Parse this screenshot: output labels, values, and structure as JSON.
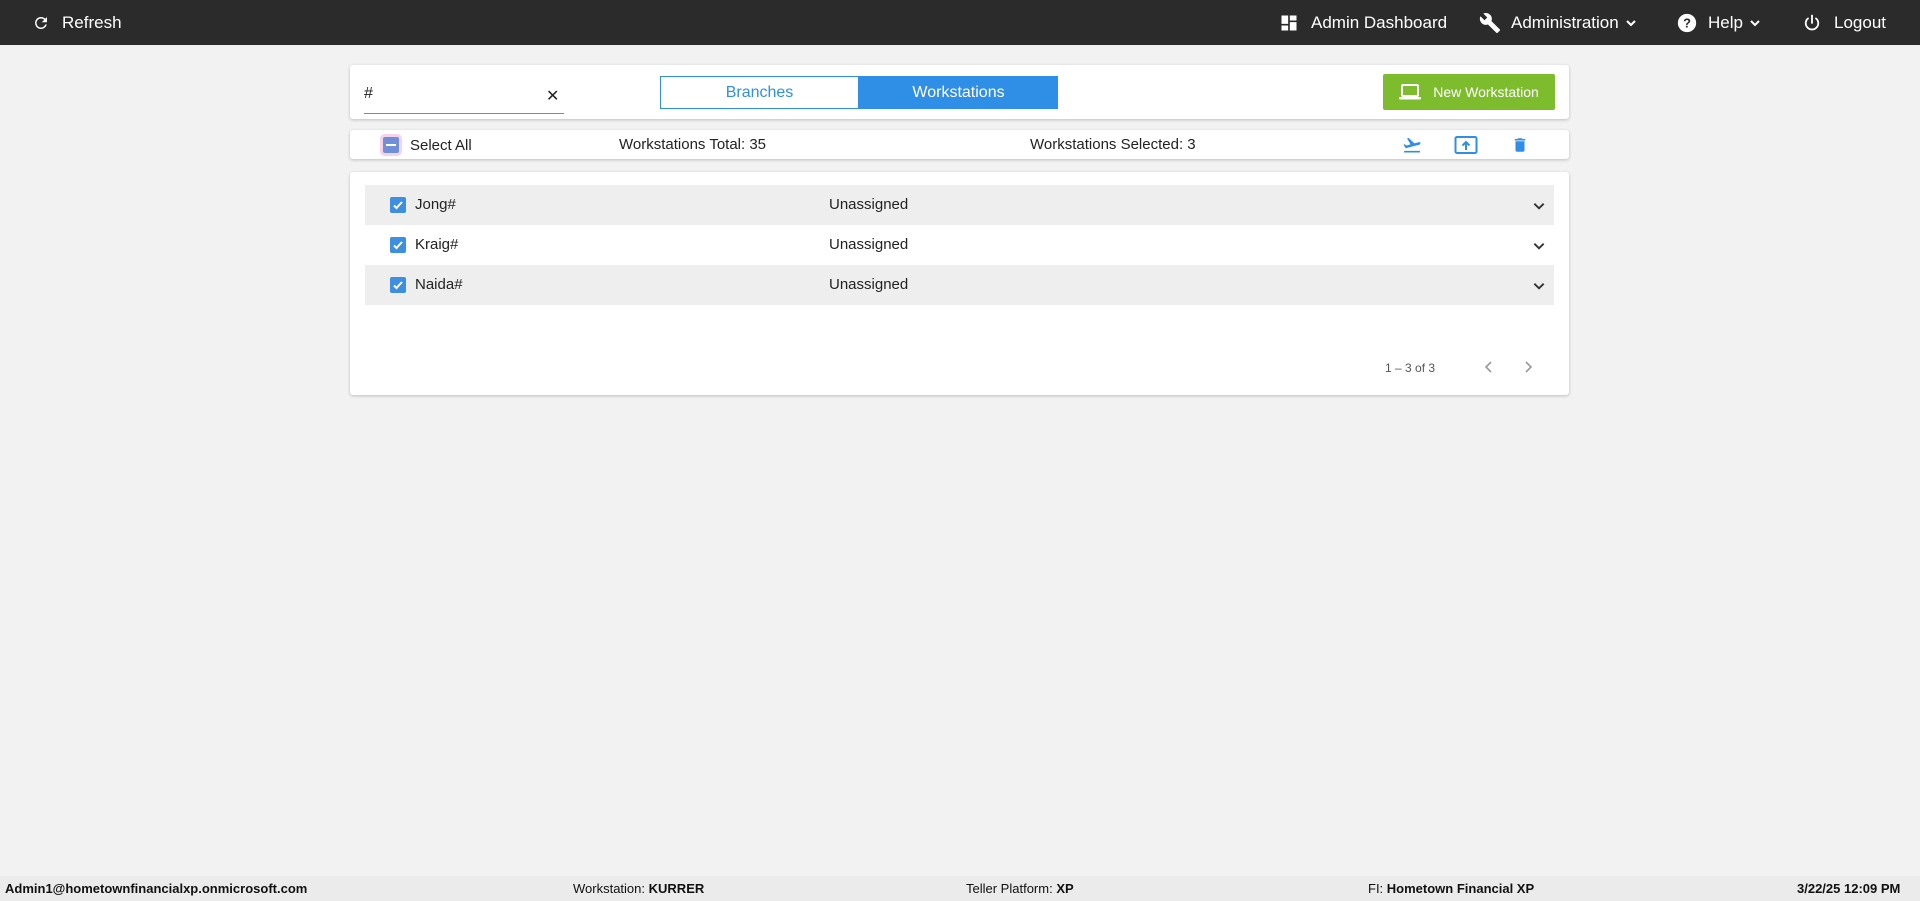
{
  "topbar": {
    "refresh_label": "Refresh",
    "dashboard_label": "Admin Dashboard",
    "administration_label": "Administration",
    "help_label": "Help",
    "logout_label": "Logout",
    "background_color": "#2b2b2b"
  },
  "search": {
    "value": "#",
    "clear_icon": "close-icon"
  },
  "tabs": [
    {
      "label": "Branches",
      "active": false
    },
    {
      "label": "Workstations",
      "active": true
    }
  ],
  "new_workstation": {
    "label": "New Workstation",
    "icon": "laptop-icon",
    "color": "#7dbd2d"
  },
  "selection": {
    "select_all_label": "Select All",
    "total_text": "Workstations Total: 35",
    "selected_text": "Workstations Selected: 3",
    "actions": [
      "airplane-depart-icon",
      "upload-icon",
      "trash-icon"
    ]
  },
  "workstations": [
    {
      "name": "Jong#",
      "status": "Unassigned",
      "checked": true
    },
    {
      "name": "Kraig#",
      "status": "Unassigned",
      "checked": true
    },
    {
      "name": "Naida#",
      "status": "Unassigned",
      "checked": true
    }
  ],
  "pagination": {
    "range_text": "1 – 3 of 3"
  },
  "footer": {
    "user": "Admin1@hometownfinancialxp.onmicrosoft.com",
    "workstation_label": "Workstation:",
    "workstation_value": "KURRER",
    "teller_platform_label": "Teller Platform:",
    "teller_platform_value": "XP",
    "fi_label": "FI:",
    "fi_value": "Hometown Financial XP",
    "datetime": "3/22/25 12:09 PM"
  },
  "colors": {
    "accent_blue": "#2f8ee5",
    "page_background": "#f2f2f2"
  }
}
